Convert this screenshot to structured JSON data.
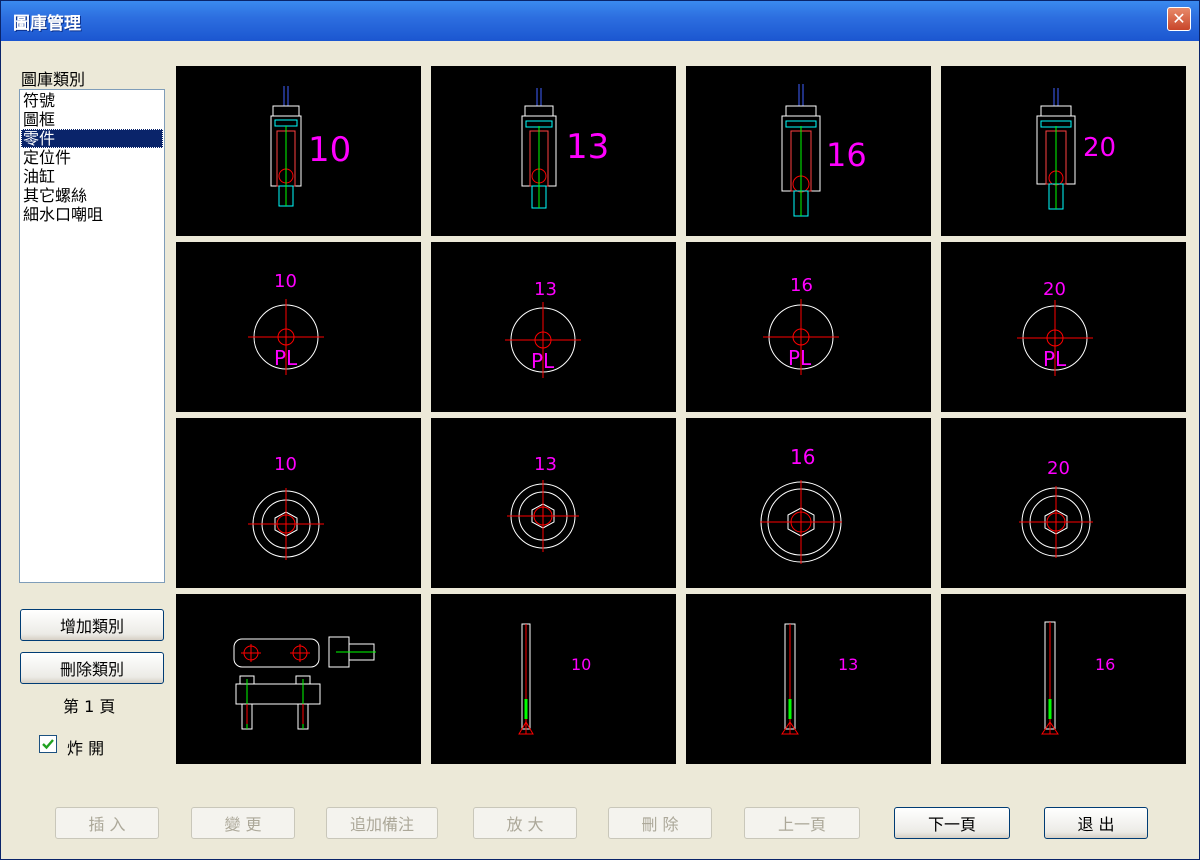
{
  "window": {
    "title": "圖庫管理",
    "close_glyph": "✕"
  },
  "sidebar": {
    "label": "圖庫類別",
    "items": [
      "符號",
      "圖框",
      "零件",
      "定位件",
      "油缸",
      "其它螺絲",
      "細水口嘲咀"
    ],
    "selected_index": 2,
    "add_button": "增加類別",
    "delete_button": "刪除類別",
    "page_label": "第 1 頁",
    "explode_label": "炸 開",
    "explode_checked": true
  },
  "thumbnails": {
    "row1": [
      "10",
      "13",
      "16",
      "20"
    ],
    "row2": [
      "10",
      "13",
      "16",
      "20"
    ],
    "row2_mark": "PL",
    "row3": [
      "10",
      "13",
      "16",
      "20"
    ],
    "row4": [
      "10",
      "13",
      "16"
    ]
  },
  "footer": {
    "insert": "插 入",
    "change": "變 更",
    "add_note": "追加備注",
    "zoom": "放 大",
    "delete": "刪 除",
    "prev_page": "上一頁",
    "next_page": "下一頁",
    "exit": "退 出"
  },
  "colors": {
    "title_bar": "#2D6FE0",
    "cad_background": "#000000",
    "cad_magenta": "#FF00FF",
    "cad_red": "#FF0000",
    "cad_cyan": "#00FFFF",
    "cad_white": "#FFFFFF",
    "selection": "#0A246A"
  }
}
